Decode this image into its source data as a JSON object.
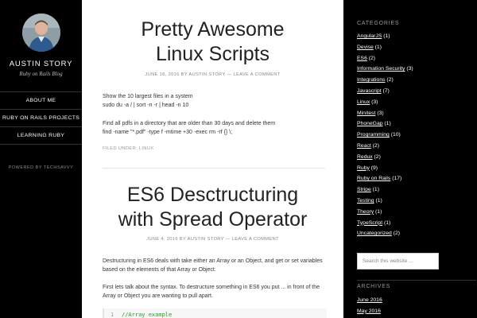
{
  "site": {
    "title": "AUSTIN STORY",
    "description": "Ruby on Rails Blog",
    "powered_by": "POWERED BY TECHSAVVY"
  },
  "nav": [
    {
      "label": "ABOUT ME"
    },
    {
      "label": "RUBY ON RAILS PROJECTS"
    },
    {
      "label": "LEARNING RUBY"
    }
  ],
  "posts": [
    {
      "title_line1": "Pretty Awesome",
      "title_line2": "Linux Scripts",
      "date": "JUNE 18, 2016",
      "author": "BY AUSTIN STORY",
      "comment_link": "LEAVE A COMMENT",
      "p1_line1": "Show the 10 largest files in a system",
      "p1_line2": "sudo du -a / | sort -n -r | head -n 10",
      "p2_line1": "Find all pdfs in a directory that are older than 30 days and delete them",
      "p2_line2": "find -name \"*.pdf\" -type f -mtime +30 -exec rm -rf {} \\;",
      "filed_under": "FILED UNDER:",
      "filed_category": "LINUX"
    },
    {
      "title_line1": "ES6 Desctructuring",
      "title_line2": "with Spread Operator",
      "date": "JUNE 4, 2016",
      "author": "BY AUSTIN STORY",
      "comment_link": "LEAVE A COMMENT",
      "p1": "Destructuring in ES6 deals with take either an Array or an Object, and get or set variables based on the elements of that Array or Object.",
      "p2": "First lets talk about the syntax. To destructure something in ES6 you put ... in front of the Array or Object you are wanting to pull apart.",
      "code_line_no": "1",
      "code_text": "//Array example"
    }
  ],
  "sidebar": {
    "categories_title": "CATEGORIES",
    "categories": [
      {
        "name": "AngularJS",
        "count": "(1)"
      },
      {
        "name": "Devise",
        "count": "(1)"
      },
      {
        "name": "ES6",
        "count": "(2)"
      },
      {
        "name": "Information Security",
        "count": "(3)"
      },
      {
        "name": "Integrations",
        "count": "(2)"
      },
      {
        "name": "Javascript",
        "count": "(7)"
      },
      {
        "name": "Linux",
        "count": "(3)"
      },
      {
        "name": "Minitest",
        "count": "(3)"
      },
      {
        "name": "PhoneGap",
        "count": "(1)"
      },
      {
        "name": "Programming",
        "count": "(10)"
      },
      {
        "name": "React",
        "count": "(2)"
      },
      {
        "name": "Redux",
        "count": "(2)"
      },
      {
        "name": "Ruby",
        "count": "(9)"
      },
      {
        "name": "Ruby on Rails",
        "count": "(17)"
      },
      {
        "name": "Stripe",
        "count": "(1)"
      },
      {
        "name": "Testing",
        "count": "(1)"
      },
      {
        "name": "Theory",
        "count": "(1)"
      },
      {
        "name": "TypeScript",
        "count": "(1)"
      },
      {
        "name": "Uncategorized",
        "count": "(2)"
      }
    ],
    "search_placeholder": "Search this website ...",
    "archives_title": "ARCHIVES",
    "archives": [
      {
        "label": "June 2016"
      },
      {
        "label": "May 2016"
      }
    ]
  }
}
